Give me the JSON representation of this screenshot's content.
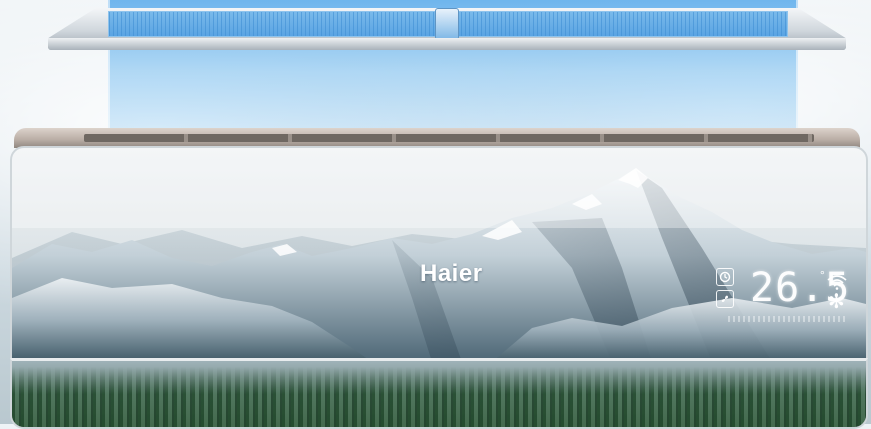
{
  "brand": {
    "logo_text": "Haier"
  },
  "display": {
    "temperature": "26.5",
    "degree_symbol": "°",
    "icons": [
      "timer-icon",
      "fan-mode-icon",
      "wifi-icon",
      "snowflake-cool-icon"
    ]
  },
  "colors": {
    "airflow_beam": "#5aa4e3",
    "filter_mesh": "#79b9ea",
    "unit_trim": "#b8aca4",
    "panel_glass": "#e1e7ea"
  }
}
